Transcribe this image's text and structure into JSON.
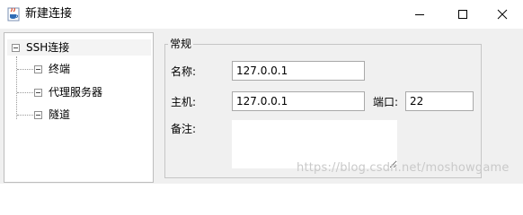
{
  "window": {
    "title": "新建连接",
    "app_icon": "java-cup-icon",
    "controls": {
      "minimize_icon": "minimize-icon",
      "maximize_icon": "maximize-icon",
      "close_icon": "close-icon"
    }
  },
  "tree": {
    "root": {
      "label": "SSH连接",
      "expanded": true
    },
    "children": [
      {
        "label": "终端"
      },
      {
        "label": "代理服务器"
      },
      {
        "label": "隧道"
      }
    ]
  },
  "panel": {
    "group_title": "常规",
    "name": {
      "label": "名称:",
      "value": "127.0.0.1"
    },
    "host": {
      "label": "主机:",
      "value": "127.0.0.1"
    },
    "port": {
      "label": "端口:",
      "value": "22"
    },
    "note": {
      "label": "备注:",
      "value": ""
    }
  },
  "watermark": "https://blog.csdn.net/moshowgame"
}
